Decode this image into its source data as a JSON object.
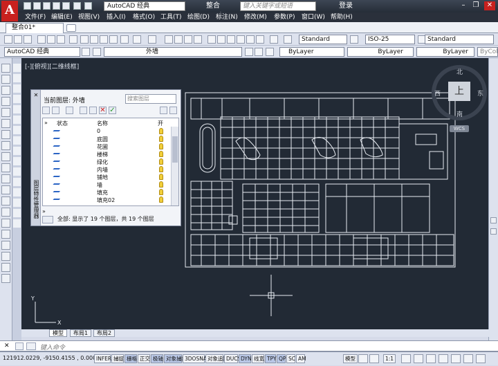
{
  "app": {
    "logo": "A",
    "workspace": "AutoCAD 经典",
    "file_name": "整合01.dwg",
    "search_placeholder": "键入关键字或短语",
    "login": "登录",
    "min": "–",
    "max": "❐",
    "close": "✕"
  },
  "menu": [
    "文件(F)",
    "编辑(E)",
    "视图(V)",
    "插入(I)",
    "格式(O)",
    "工具(T)",
    "绘图(D)",
    "标注(N)",
    "修改(M)",
    "参数(P)",
    "窗口(W)",
    "帮助(H)"
  ],
  "document_tab": "整合01*",
  "toolbar1": {
    "text_style": "Standard",
    "dim_style": "ISO-25",
    "table_style": "Standard"
  },
  "toolbar2": {
    "workspace": "AutoCAD 经典",
    "layer": "外墙",
    "color": "ByLayer",
    "linetype": "ByLayer",
    "lineweight": "ByLayer",
    "plotstyle": "ByColor"
  },
  "viewport_label": "[-][俯视][二维线框]",
  "compass": {
    "top": "上",
    "north": "北",
    "south": "南",
    "east": "东",
    "west": "西",
    "wcs": "WCS"
  },
  "layer_palette": {
    "close": "✕",
    "current_layer": "当前图层: 外墙",
    "search_placeholder": "搜索图层",
    "side_label": "图层特性管理器",
    "columns": {
      "status": "状态",
      "name": "名称",
      "on": "开"
    },
    "expand": "»",
    "layers": [
      "0",
      "底圆",
      "花圃",
      "楼梯",
      "绿化",
      "内墙",
      "铺地",
      "墙",
      "填充",
      "填充02"
    ],
    "footer": "全部: 显示了 19 个图层，共 19 个图层"
  },
  "layout_tabs": [
    "模型",
    "布局1",
    "布局2"
  ],
  "command_prompt": "键入命令",
  "status": {
    "coords": "121912.0229, -9150.4155 , 0.0000",
    "toggles": [
      "INFER",
      "捕捉",
      "栅格",
      "正交",
      "极轴",
      "对象捕捉",
      "3DOSNAP",
      "对象追踪",
      "DUCS",
      "DYN",
      "线宽",
      "TPY",
      "QP",
      "SC",
      "AM"
    ],
    "toggles_on": [
      "栅格",
      "极轴",
      "对象捕捉",
      "DYN",
      "TPY",
      "QP"
    ],
    "model": "模型",
    "scale": "1:1"
  }
}
